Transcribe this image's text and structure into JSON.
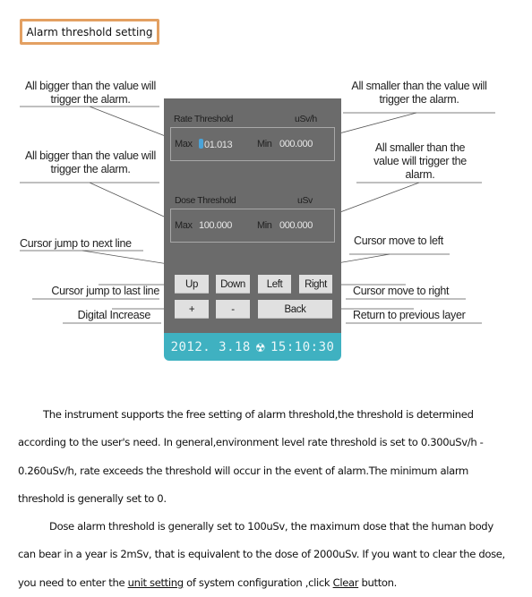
{
  "header": {
    "title": "Alarm threshold setting"
  },
  "annotations": {
    "rate_max": "All bigger than the value will trigger the alarm.",
    "rate_min": "All smaller than the value will trigger the alarm.",
    "dose_max": "All bigger than the value will trigger the alarm.",
    "dose_min": "All smaller than the value will trigger the alarm.",
    "down": "Cursor jump to next line",
    "left": "Cursor move to left",
    "up": "Cursor jump to last line",
    "right": "Cursor move to right",
    "plus": "Digital Increase",
    "back": "Return to previous layer"
  },
  "device": {
    "rate": {
      "label": "Rate Threshold",
      "unit": "uSv/h",
      "max_label": "Max",
      "max_value": "01.013",
      "min_label": "Min",
      "min_value": "000.000"
    },
    "dose": {
      "label": "Dose Threshold",
      "unit": "uSv",
      "max_label": "Max",
      "max_value": "100.000",
      "min_label": "Min",
      "min_value": "000.000"
    },
    "buttons": {
      "up": "Up",
      "down": "Down",
      "left": "Left",
      "right": "Right",
      "plus": "+",
      "minus": "-",
      "back": "Back"
    },
    "status": {
      "date": "2012. 3.18",
      "icon": "radiation-icon",
      "time": "15:10:30"
    },
    "colors": {
      "panel": "#6b6b6b",
      "status_bar": "#3fb1c1",
      "cursor": "#4aa3d8"
    }
  },
  "body": {
    "p1": [
      "The instrument supports the free setting of alarm threshold,the threshold is determined",
      "according to the user's need.  In general,environment  level rate threshold is set to 0.300uSv/h -",
      "0.260uSv/h,  rate exceeds the threshold will occur in the event of alarm.The minimum alarm",
      "threshold is generally set to 0."
    ],
    "p2": [
      "Dose alarm threshold is generally set to 100uSv, the maximum dose that the human body",
      "can bear in a year is 2mSv, that is equivalent to the dose of 2000uSv. If you want to clear the dose,"
    ],
    "p2_last": {
      "pre": "you need to enter the ",
      "link1": "unit setting",
      "mid": " of system configuration ,click ",
      "link2": "Clear",
      "post": " button."
    }
  }
}
